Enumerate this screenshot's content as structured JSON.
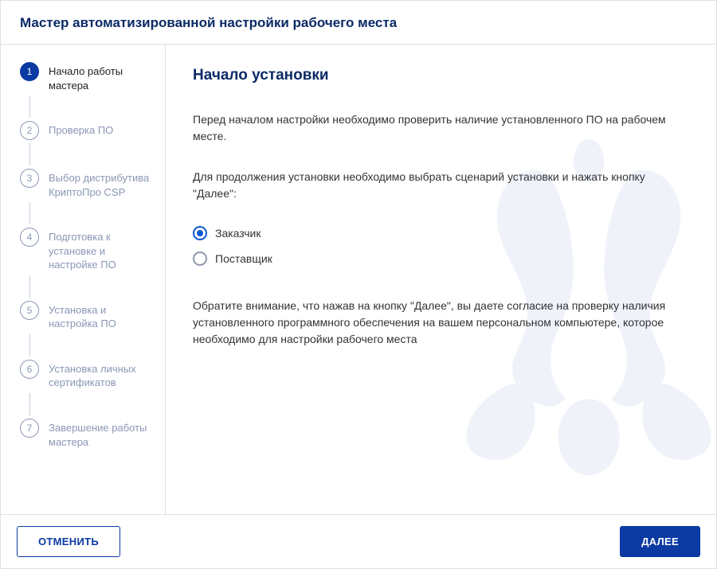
{
  "header": {
    "title": "Мастер автоматизированной настройки рабочего места"
  },
  "sidebar": {
    "steps": [
      {
        "num": "1",
        "label": "Начало работы мастера",
        "active": true
      },
      {
        "num": "2",
        "label": "Проверка ПО",
        "active": false
      },
      {
        "num": "3",
        "label": "Выбор дистрибутива КриптоПро CSP",
        "active": false
      },
      {
        "num": "4",
        "label": "Подготовка к установке и настройке ПО",
        "active": false
      },
      {
        "num": "5",
        "label": "Установка и настройка ПО",
        "active": false
      },
      {
        "num": "6",
        "label": "Установка личных сертификатов",
        "active": false
      },
      {
        "num": "7",
        "label": "Завершение работы мастера",
        "active": false
      }
    ]
  },
  "content": {
    "heading": "Начало установки",
    "para1": "Перед началом настройки необходимо проверить наличие установленного ПО на рабочем месте.",
    "para2": "Для продолжения установки необходимо выбрать сценарий установки и нажать кнопку \"Далее\":",
    "options": [
      {
        "label": "Заказчик",
        "checked": true
      },
      {
        "label": "Поставщик",
        "checked": false
      }
    ],
    "note": "Обратите внимание, что нажав на кнопку \"Далее\", вы даете согласие на проверку наличия установленного программного обеспечения на вашем персональном компьютере, которое необходимо для настройки рабочего места"
  },
  "footer": {
    "cancel": "ОТМЕНИТЬ",
    "next": "ДАЛЕЕ"
  }
}
